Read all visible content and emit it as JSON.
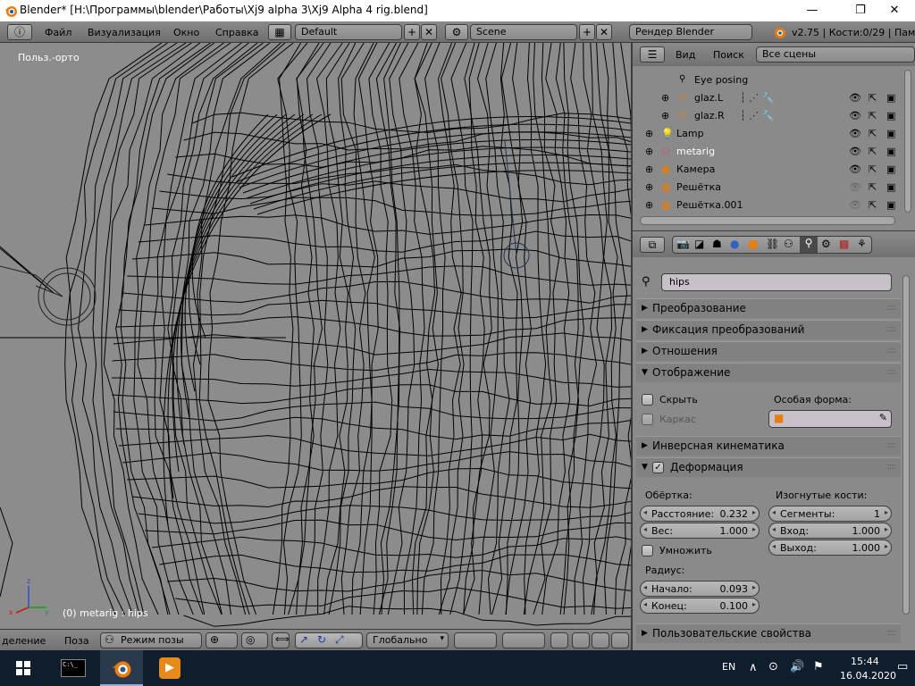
{
  "window": {
    "title": "Blender* [H:\\Программы\\blender\\Работы\\Xj9 alpha 3\\Xj9 Alpha 4 rig.blend]",
    "min": "—",
    "max": "❐",
    "close": "✕"
  },
  "topbar": {
    "menus": [
      "Файл",
      "Визуализация",
      "Окно",
      "Справка"
    ],
    "layout": "Default",
    "scene": "Scene",
    "engine": "Рендер Blender",
    "stats": "v2.75 | Кости:0/29 | Пам."
  },
  "viewport": {
    "label": "Польз.-орто",
    "status": "(0) metarig : hips"
  },
  "viewport_header": {
    "select_menu": "деление",
    "pose_menu": "Поза",
    "mode": "Режим позы",
    "orientation": "Глобально"
  },
  "outliner": {
    "view": "Вид",
    "search": "Поиск",
    "scenes": "Все сцены",
    "items": [
      {
        "label": "Eye posing"
      },
      {
        "label": "glaz.L"
      },
      {
        "label": "glaz.R"
      },
      {
        "label": "Lamp"
      },
      {
        "label": "metarig"
      },
      {
        "label": "Камера"
      },
      {
        "label": "Решётка"
      },
      {
        "label": "Решётка.001"
      }
    ]
  },
  "props": {
    "bone_name": "hips",
    "panels": {
      "transform": "Преобразование",
      "lock": "Фиксация преобразований",
      "relations": "Отношения",
      "display": "Отображение",
      "ik": "Инверсная кинематика",
      "deform": "Деформация",
      "custom": "Пользовательские свойства"
    },
    "display": {
      "hide": "Скрыть",
      "wire": "Каркас",
      "custom_shape": "Особая форма:"
    },
    "deform": {
      "envelope": "Обёртка:",
      "distance_label": "Расстояние:",
      "distance": "0.232",
      "weight_label": "Вес:",
      "weight": "1.000",
      "multiply": "Умножить",
      "radius": "Радиус:",
      "head_label": "Начало:",
      "head": "0.093",
      "tail_label": "Конец:",
      "tail": "0.100",
      "bendy": "Изогнутые кости:",
      "segments_label": "Сегменты:",
      "segments": "1",
      "in_label": "Вход:",
      "in": "1.000",
      "out_label": "Выход:",
      "out": "1.000"
    }
  },
  "taskbar": {
    "lang": "EN",
    "time": "15:44",
    "date": "16.04.2020"
  },
  "colors": {
    "viewport": "#8c8c8c",
    "panel": "#8a8a8a",
    "taskbar": "#101d2c",
    "selected": "#ffaf29"
  }
}
